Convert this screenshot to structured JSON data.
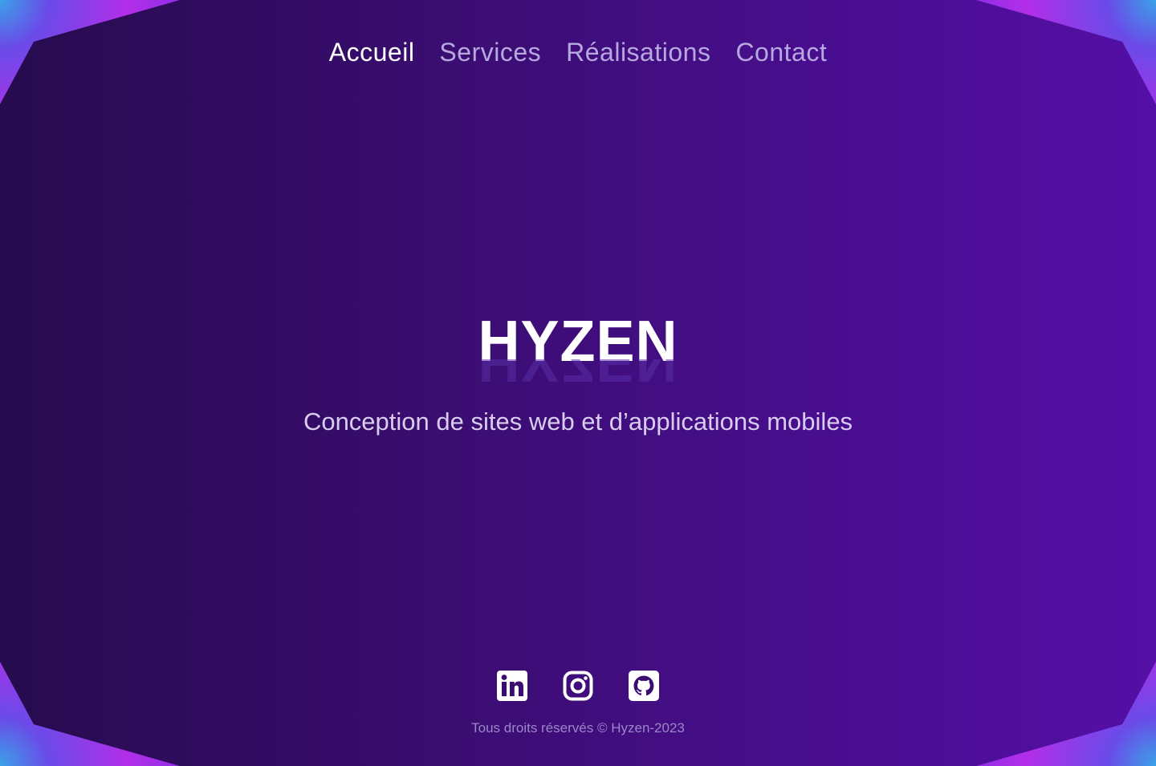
{
  "nav": {
    "items": [
      {
        "label": "Accueil",
        "active": true
      },
      {
        "label": "Services",
        "active": false
      },
      {
        "label": "Réalisations",
        "active": false
      },
      {
        "label": "Contact",
        "active": false
      }
    ]
  },
  "hero": {
    "brand": "HYZEN",
    "tagline": "Conception de sites web et d’applications mobiles"
  },
  "socials": [
    {
      "icon": "linkedin-icon"
    },
    {
      "icon": "instagram-icon"
    },
    {
      "icon": "github-icon"
    }
  ],
  "footer": {
    "text": "Tous droits réservés © Hyzen-2023"
  },
  "colors": {
    "background_start": "#260b4e",
    "background_end": "#540fa6",
    "corner_accent": "#b22ee8",
    "text_primary": "#ffffff",
    "nav_inactive": "#b7a8e0"
  }
}
